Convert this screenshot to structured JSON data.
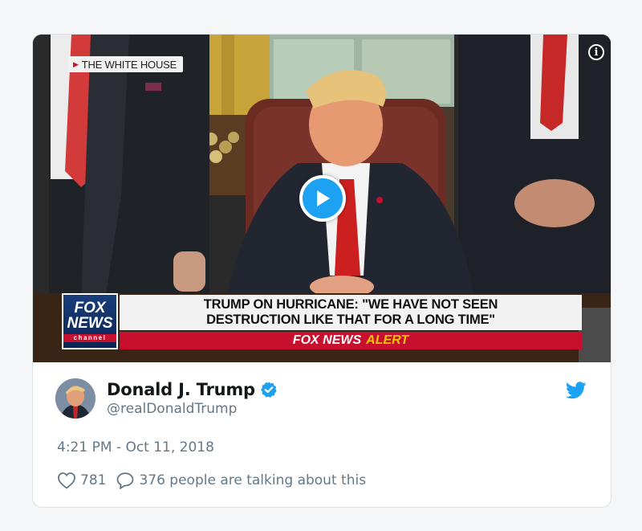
{
  "tweet": {
    "video": {
      "location_tag": "THE WHITE HOUSE",
      "chyron": {
        "network_logo": {
          "line1": "FOX",
          "line2": "NEWS",
          "line3": "channel"
        },
        "headline_line1": "TRUMP ON HURRICANE: \"WE HAVE NOT SEEN",
        "headline_line2": "DESTRUCTION LIKE THAT FOR A LONG TIME\"",
        "alert_brand": "FOX NEWS",
        "alert_label": "ALERT"
      }
    },
    "author": {
      "name": "Donald J. Trump",
      "handle": "@realDonaldTrump",
      "verified": true
    },
    "timestamp": "4:21 PM - Oct 11, 2018",
    "likes": "781",
    "talking": "376 people are talking about this"
  },
  "icons": {
    "play": "play-icon",
    "info": "info-icon",
    "verified": "verified-badge-icon",
    "bird": "twitter-bird-icon",
    "like": "heart-icon",
    "reply": "speech-bubble-icon"
  },
  "colors": {
    "twitter_blue": "#1da1f2",
    "fox_red": "#c8102e",
    "fox_blue": "#0b2456",
    "alert_yellow": "#f5c400",
    "muted_text": "#657786",
    "name_text": "#14171a"
  }
}
